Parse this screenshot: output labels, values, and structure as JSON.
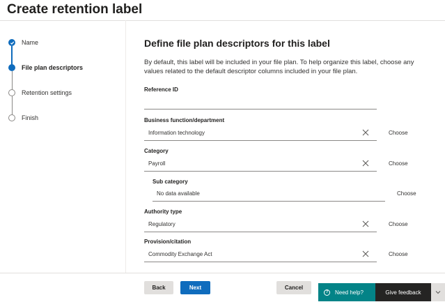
{
  "page": {
    "title": "Create retention label"
  },
  "steps": [
    {
      "label": "Name",
      "state": "done"
    },
    {
      "label": "File plan descriptors",
      "state": "current"
    },
    {
      "label": "Retention settings",
      "state": "todo"
    },
    {
      "label": "Finish",
      "state": "todo"
    }
  ],
  "form": {
    "title": "Define file plan descriptors for this label",
    "description": "By default, this label will be included in your file plan. To help organize this label, choose any values related to the default descriptor columns included in your file plan.",
    "reference_id": {
      "label": "Reference ID",
      "value": ""
    },
    "business_function": {
      "label": "Business function/department",
      "value": "Information technology",
      "choose": "Choose"
    },
    "category": {
      "label": "Category",
      "value": "Payroll",
      "choose": "Choose"
    },
    "sub_category": {
      "label": "Sub category",
      "value": "No data available",
      "choose": "Choose"
    },
    "authority_type": {
      "label": "Authority type",
      "value": "Regulatory",
      "choose": "Choose"
    },
    "provision": {
      "label": "Provision/citation",
      "value": "Commodity Exchange Act",
      "choose": "Choose"
    }
  },
  "footer": {
    "back": "Back",
    "next": "Next",
    "cancel": "Cancel",
    "need_help": "Need help?",
    "give_feedback": "Give feedback"
  },
  "colors": {
    "accent": "#0f6cbd",
    "help": "#038387",
    "feedback": "#252423"
  },
  "icons": {
    "clear": "close-icon",
    "done_step": "check-icon",
    "help": "question-icon",
    "collapse": "chevron-down-icon"
  }
}
